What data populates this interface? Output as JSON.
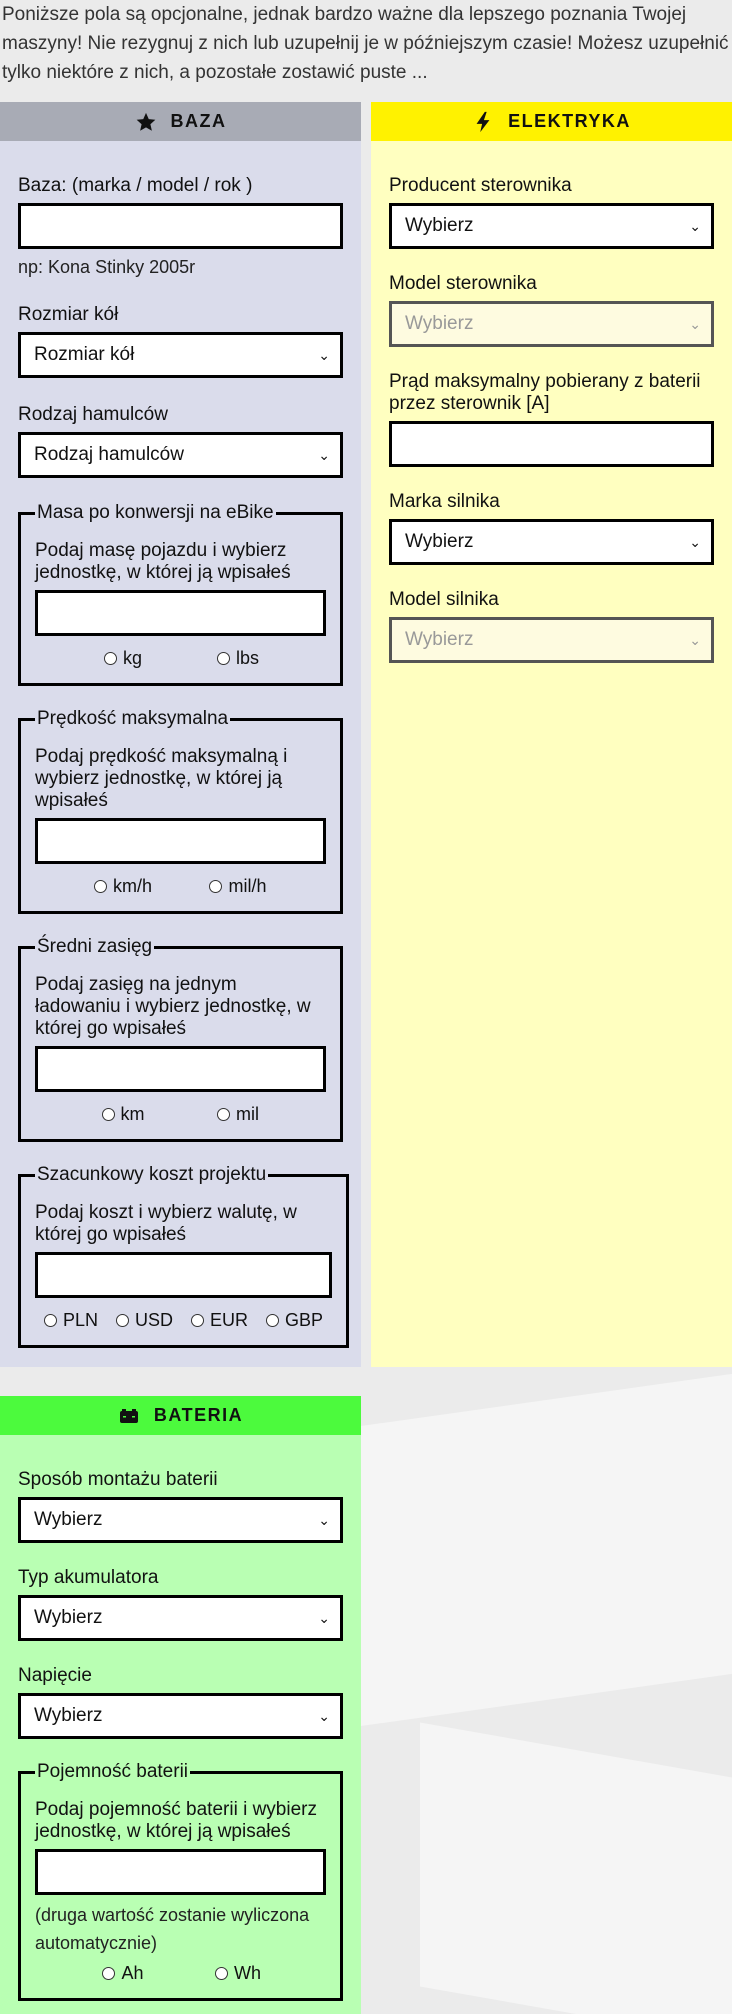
{
  "intro": "Poniższe pola są opcjonalne, jednak bardzo ważne dla lepszego poznania Twojej maszyny! Nie rezygnuj z nich lub uzupełnij je w późniejszym czasie! Możesz uzupełnić tylko niektóre z nich, a pozostałe zostawić puste ...",
  "colors": {
    "baza_header": "#a8abb5",
    "baza_body": "#dadceb",
    "elektryka_header": "#fff200",
    "elektryka_body": "#ffffc0",
    "bateria_header": "#4cfa3d",
    "bateria_body": "#b9ffb3"
  },
  "baza": {
    "title": "BAZA",
    "icon": "star-icon",
    "base_label": "Baza: (marka / model / rok )",
    "base_hint": "np: Kona Stinky 2005r",
    "wheel_label": "Rozmiar kół",
    "wheel_value": "Rozmiar kół",
    "brake_label": "Rodzaj hamulców",
    "brake_value": "Rodzaj hamulców",
    "mass": {
      "legend": "Masa po konwersji na eBike",
      "desc": "Podaj masę pojazdu i wybierz jednostkę, w której ją wpisałeś",
      "units": [
        "kg",
        "lbs"
      ]
    },
    "speed": {
      "legend": "Prędkość maksymalna",
      "desc": "Podaj prędkość maksymalną i wybierz jednostkę, w której ją wpisałeś",
      "units": [
        "km/h",
        "mil/h"
      ]
    },
    "range": {
      "legend": "Średni zasięg",
      "desc": "Podaj zasięg na jednym ładowaniu i wybierz jednostkę, w której go wpisałeś",
      "units": [
        "km",
        "mil"
      ]
    },
    "cost": {
      "legend": "Szacunkowy koszt projektu",
      "desc": "Podaj koszt i wybierz walutę, w której go wpisałeś",
      "units": [
        "PLN",
        "USD",
        "EUR",
        "GBP"
      ]
    }
  },
  "elektryka": {
    "title": "ELEKTRYKA",
    "icon": "lightning-icon",
    "controller_maker_label": "Producent sterownika",
    "controller_maker_value": "Wybierz",
    "controller_model_label": "Model sterownika",
    "controller_model_value": "Wybierz",
    "max_current_label": "Prąd maksymalny pobierany z baterii przez sterownik [A]",
    "motor_brand_label": "Marka silnika",
    "motor_brand_value": "Wybierz",
    "motor_model_label": "Model silnika",
    "motor_model_value": "Wybierz"
  },
  "bateria": {
    "title": "BATERIA",
    "icon": "battery-icon",
    "mount_label": "Sposób montażu baterii",
    "mount_value": "Wybierz",
    "type_label": "Typ akumulatora",
    "type_value": "Wybierz",
    "voltage_label": "Napięcie",
    "voltage_value": "Wybierz",
    "capacity": {
      "legend": "Pojemność baterii",
      "desc": "Podaj pojemność baterii i wybierz jednostkę, w której ją wpisałeś",
      "note": "(druga wartość zostanie wyliczona automatycznie)",
      "units": [
        "Ah",
        "Wh"
      ]
    }
  }
}
